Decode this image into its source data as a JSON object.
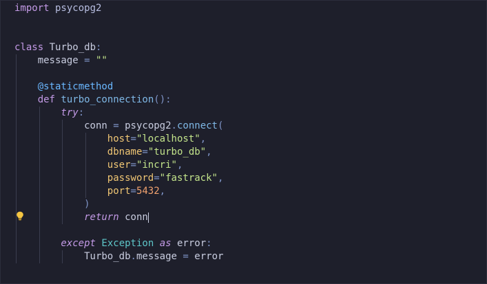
{
  "theme": {
    "background": "#1e1f2b",
    "default": "#c9cde0",
    "keyword": "#c39ae6",
    "module": "#b7bde0",
    "function": "#7fb8e6",
    "string": "#c3e48b",
    "number": "#f2a26f",
    "param": "#f0c674",
    "decorator": "#6ab7ff",
    "class": "#5ec6c9",
    "punct": "#7f94c7",
    "bulb": "#f5c542"
  },
  "editor": {
    "lines": [
      {
        "indent": 0,
        "tokens": [
          {
            "t": "import",
            "c": "keyword"
          },
          {
            "t": " psycopg2",
            "c": "module"
          }
        ]
      },
      {
        "indent": 0,
        "tokens": []
      },
      {
        "indent": 0,
        "tokens": []
      },
      {
        "indent": 0,
        "tokens": [
          {
            "t": "class",
            "c": "keyword"
          },
          {
            "t": " Turbo_db",
            "c": "default"
          },
          {
            "t": ":",
            "c": "punct"
          }
        ]
      },
      {
        "indent": 1,
        "tokens": [
          {
            "t": "message",
            "c": "default"
          },
          {
            "t": " = ",
            "c": "punct"
          },
          {
            "t": "\"\"",
            "c": "string"
          }
        ]
      },
      {
        "indent": 1,
        "tokens": []
      },
      {
        "indent": 1,
        "tokens": [
          {
            "t": "@staticmethod",
            "c": "decorator"
          }
        ]
      },
      {
        "indent": 1,
        "tokens": [
          {
            "t": "def",
            "c": "keyword"
          },
          {
            "t": " ",
            "c": "default"
          },
          {
            "t": "turbo_connection",
            "c": "function"
          },
          {
            "t": "():",
            "c": "punct"
          }
        ]
      },
      {
        "indent": 2,
        "tokens": [
          {
            "t": "try",
            "c": "keyword",
            "i": true
          },
          {
            "t": ":",
            "c": "punct"
          }
        ]
      },
      {
        "indent": 3,
        "tokens": [
          {
            "t": "conn",
            "c": "default"
          },
          {
            "t": " = ",
            "c": "punct"
          },
          {
            "t": "psycopg2",
            "c": "default"
          },
          {
            "t": ".",
            "c": "punct"
          },
          {
            "t": "connect",
            "c": "function"
          },
          {
            "t": "(",
            "c": "punct"
          }
        ]
      },
      {
        "indent": 4,
        "tokens": [
          {
            "t": "host",
            "c": "param"
          },
          {
            "t": "=",
            "c": "punct"
          },
          {
            "t": "\"localhost\"",
            "c": "string"
          },
          {
            "t": ",",
            "c": "punct"
          }
        ]
      },
      {
        "indent": 4,
        "tokens": [
          {
            "t": "dbname",
            "c": "param"
          },
          {
            "t": "=",
            "c": "punct"
          },
          {
            "t": "\"turbo_db\"",
            "c": "string"
          },
          {
            "t": ",",
            "c": "punct"
          }
        ]
      },
      {
        "indent": 4,
        "tokens": [
          {
            "t": "user",
            "c": "param"
          },
          {
            "t": "=",
            "c": "punct"
          },
          {
            "t": "\"incri\"",
            "c": "string"
          },
          {
            "t": ",",
            "c": "punct"
          }
        ]
      },
      {
        "indent": 4,
        "tokens": [
          {
            "t": "password",
            "c": "param"
          },
          {
            "t": "=",
            "c": "punct"
          },
          {
            "t": "\"fastrack\"",
            "c": "string"
          },
          {
            "t": ",",
            "c": "punct"
          }
        ]
      },
      {
        "indent": 4,
        "tokens": [
          {
            "t": "port",
            "c": "param"
          },
          {
            "t": "=",
            "c": "punct"
          },
          {
            "t": "5432",
            "c": "number"
          },
          {
            "t": ",",
            "c": "punct"
          }
        ]
      },
      {
        "indent": 3,
        "tokens": [
          {
            "t": ")",
            "c": "punct"
          }
        ]
      },
      {
        "indent": 3,
        "cursor": true,
        "tokens": [
          {
            "t": "return",
            "c": "keyword",
            "i": true
          },
          {
            "t": " conn",
            "c": "default"
          }
        ]
      },
      {
        "indent": 2,
        "tokens": []
      },
      {
        "indent": 2,
        "tokens": [
          {
            "t": "except",
            "c": "keyword",
            "i": true
          },
          {
            "t": " ",
            "c": "default"
          },
          {
            "t": "Exception",
            "c": "class"
          },
          {
            "t": " ",
            "c": "default"
          },
          {
            "t": "as",
            "c": "keyword",
            "i": true
          },
          {
            "t": " error",
            "c": "default"
          },
          {
            "t": ":",
            "c": "punct"
          }
        ]
      },
      {
        "indent": 3,
        "tokens": [
          {
            "t": "Turbo_db",
            "c": "default"
          },
          {
            "t": ".",
            "c": "punct"
          },
          {
            "t": "message",
            "c": "default"
          },
          {
            "t": " = ",
            "c": "punct"
          },
          {
            "t": "error",
            "c": "default"
          }
        ]
      }
    ]
  },
  "gutter": {
    "lightbulb_icon": "lightbulb-icon",
    "lightbulb_line": 17
  }
}
